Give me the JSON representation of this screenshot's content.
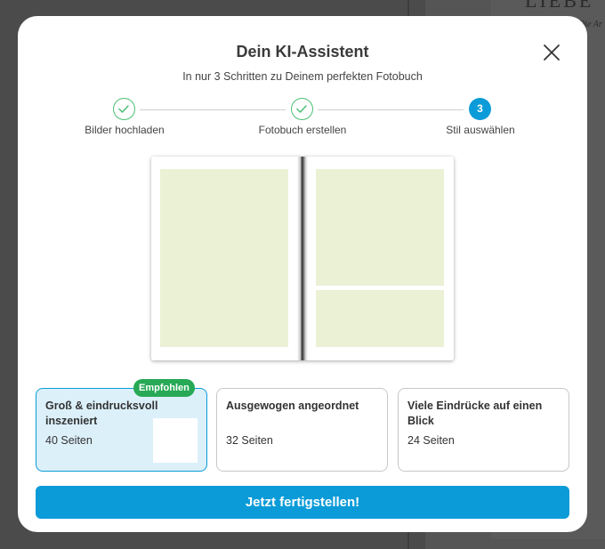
{
  "background": {
    "text_1": "LIEBE",
    "text_2": "Die Ar"
  },
  "modal": {
    "title": "Dein KI-Assistent",
    "subtitle": "In nur 3 Schritten zu Deinem perfekten Fotobuch",
    "close_icon": "close-icon"
  },
  "steps": [
    {
      "label": "Bilder hochladen",
      "state": "done",
      "icon": "check-icon"
    },
    {
      "label": "Fotobuch erstellen",
      "state": "done",
      "icon": "check-icon"
    },
    {
      "label": "Stil auswählen",
      "state": "active",
      "number": "3"
    }
  ],
  "options": [
    {
      "title": "Groß & eindrucksvoll inszeniert",
      "pages": "40 Seiten",
      "badge": "Empfohlen",
      "selected": true
    },
    {
      "title": "Ausgewogen angeordnet",
      "pages": "32 Seiten",
      "selected": false
    },
    {
      "title": "Viele Eindrücke auf einen Blick",
      "pages": "24 Seiten",
      "selected": false
    }
  ],
  "cta": {
    "label": "Jetzt fertigstellen!"
  },
  "colors": {
    "accent": "#0a9bd8",
    "success": "#27a956",
    "photo_placeholder": "#eaf1d5"
  }
}
